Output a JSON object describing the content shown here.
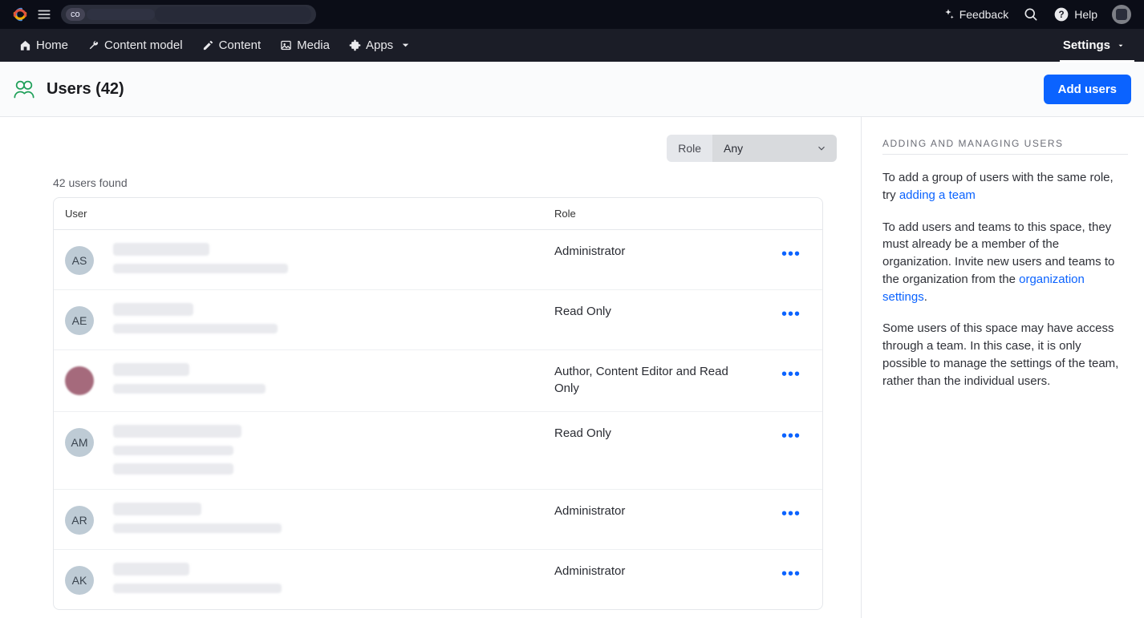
{
  "topbar": {
    "feedback_label": "Feedback",
    "help_label": "Help",
    "org_prefix": "co"
  },
  "nav": {
    "home": "Home",
    "content_model": "Content model",
    "content": "Content",
    "media": "Media",
    "apps": "Apps",
    "settings": "Settings"
  },
  "header": {
    "title": "Users (42)",
    "add_button": "Add users"
  },
  "filter": {
    "role_label": "Role",
    "role_value": "Any"
  },
  "found_text": "42 users found",
  "table": {
    "col_user": "User",
    "col_role": "Role"
  },
  "rows": [
    {
      "initials": "AS",
      "avatar_type": "grey",
      "role": "Administrator",
      "name_w": 120,
      "email_w": 218
    },
    {
      "initials": "AE",
      "avatar_type": "grey",
      "role": "Read Only",
      "name_w": 100,
      "email_w": 205
    },
    {
      "initials": "",
      "avatar_type": "pink",
      "role": "Author, Content Editor and Read Only",
      "name_w": 95,
      "email_w": 190
    },
    {
      "initials": "AM",
      "avatar_type": "grey",
      "role": "Read Only",
      "name_w": 160,
      "email_w": 150,
      "extra_line_w": 150
    },
    {
      "initials": "AR",
      "avatar_type": "grey",
      "role": "Administrator",
      "name_w": 110,
      "email_w": 210
    },
    {
      "initials": "AK",
      "avatar_type": "grey",
      "role": "Administrator",
      "name_w": 95,
      "email_w": 210
    }
  ],
  "sidebar": {
    "heading": "ADDING AND MANAGING USERS",
    "p1_before": "To add a group of users with the same role, try ",
    "p1_link": "adding a team",
    "p2_before": "To add users and teams to this space, they must already be a member of the organization. Invite new users and teams to the organization from the ",
    "p2_link": "organization settings",
    "p2_after": ".",
    "p3": "Some users of this space may have access through a team. In this case, it is only possible to manage the settings of the team, rather than the individual users."
  }
}
